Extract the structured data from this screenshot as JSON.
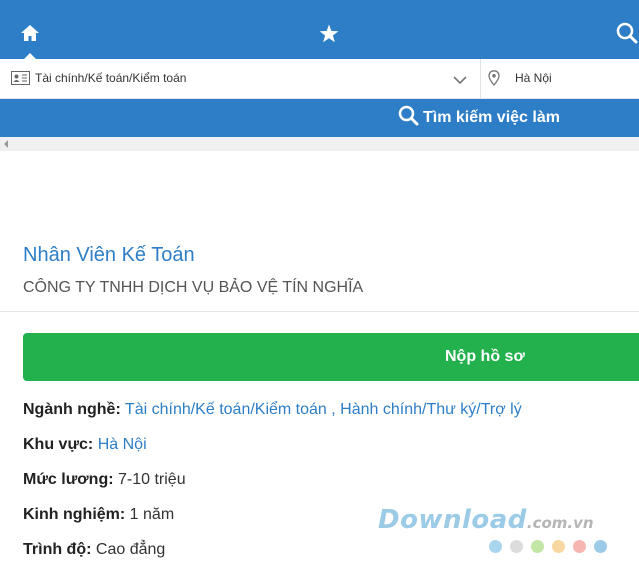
{
  "nav": {
    "home_icon": "home-icon",
    "favorite_icon": "star-icon",
    "search_icon": "search-icon"
  },
  "filters": {
    "category": "Tài chính/Kế toán/Kiểm toán",
    "location": "Hà Nội"
  },
  "search": {
    "button_label": "Tìm kiếm việc làm"
  },
  "job": {
    "title": "Nhân Viên Kế Toán",
    "company": "CÔNG TY TNHH DỊCH VỤ BẢO VỆ TÍN NGHĨA",
    "apply_label": "Nộp hồ sơ",
    "details": {
      "industry_label": "Ngành nghề:",
      "industry_value_1": "Tài chính/Kế toán/Kiểm toán",
      "industry_sep": " , ",
      "industry_value_2": "Hành chính/Thư ký/Trợ lý",
      "region_label": "Khu vực:",
      "region_value": "Hà Nội",
      "salary_label": "Mức lương:",
      "salary_value": "7-10 triệu",
      "experience_label": "Kinh nghiệm:",
      "experience_value": "1 năm",
      "education_label": "Trình độ:",
      "education_value": "Cao đẳng"
    }
  },
  "watermark": {
    "brand": "Download",
    "domain": ".com.vn",
    "dot_colors": [
      "#a9d5ef",
      "#dcdcdc",
      "#c3e6a6",
      "#f8d8a0",
      "#f7b6b0",
      "#9ccbe8"
    ]
  },
  "colors": {
    "primary": "#2d7ec7",
    "apply": "#22b14c"
  }
}
